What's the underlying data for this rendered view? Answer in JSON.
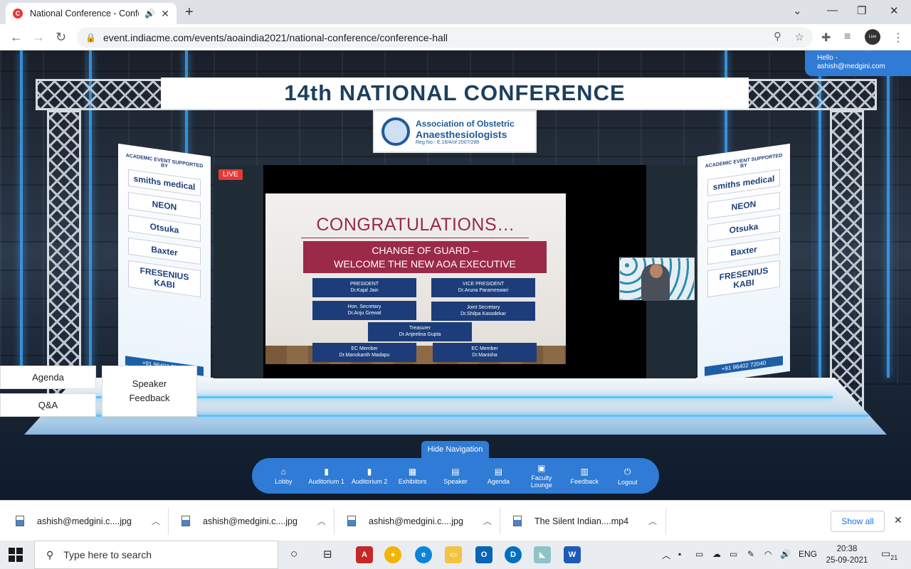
{
  "browser": {
    "tab_title": "National Conference - Confe",
    "url": "event.indiacme.com/events/aoaindia2021/national-conference/conference-hall",
    "profile_label": "Live Truth"
  },
  "page": {
    "hello_line1": "Hello -",
    "hello_line2": "ashish@medgini.com",
    "banner_title": "14th NATIONAL CONFERENCE",
    "logo": {
      "line1": "Association of Obstetric",
      "line2": "Anaesthesiologists",
      "line3": "Reg No:- E.16/4/of 2007/288"
    },
    "live_label": "LIVE",
    "slide": {
      "heading": "CONGRATULATIONS…",
      "banner_line1": "CHANGE OF GUARD –",
      "banner_line2": "WELCOME THE NEW AOA EXECUTIVE",
      "roles": [
        {
          "title": "PRESIDENT",
          "name": "Dr.Kajal Jain"
        },
        {
          "title": "VICE PRESIDENT",
          "name": "Dr.Aruna Parameswari"
        },
        {
          "title": "Hon. Secretary",
          "name": "Dr.Anju Grewal"
        },
        {
          "title": "Joint Secretary",
          "name": "Dr.Shilpa Kasodekar"
        },
        {
          "title": "Treasurer",
          "name": "Dr.Anjeelina Gupta"
        },
        {
          "title": "EC Member",
          "name": "Dr.Manokanth Madapu"
        },
        {
          "title": "EC Member",
          "name": "Dr.Manisha"
        }
      ]
    },
    "side_panel": {
      "heading": "ACADEMIC EVENT SUPPORTED BY",
      "sponsors": [
        "smiths medical",
        "NEON",
        "Otsuka",
        "Baxter",
        "FRESENIUS KABI"
      ],
      "phone": "+91 96402 72040"
    },
    "tiles": {
      "agenda": "Agenda",
      "qa": "Q&A",
      "speaker_feedback_1": "Speaker",
      "speaker_feedback_2": "Feedback"
    },
    "hide_navigation": "Hide Navigation",
    "nav": [
      {
        "label": "Lobby",
        "icon": "home-icon"
      },
      {
        "label": "Auditorium 1",
        "icon": "auditorium-icon"
      },
      {
        "label": "Auditorium 2",
        "icon": "auditorium-icon"
      },
      {
        "label": "Exhibitors",
        "icon": "exhibitors-icon"
      },
      {
        "label": "Speaker",
        "icon": "document-icon"
      },
      {
        "label": "Agenda",
        "icon": "document-icon"
      },
      {
        "label": "Faculty Lounge",
        "icon": "lounge-icon"
      },
      {
        "label": "Feedback",
        "icon": "feedback-icon"
      },
      {
        "label": "Logout",
        "icon": "power-icon"
      }
    ]
  },
  "downloads": {
    "items": [
      "ashish@medgini.c....jpg",
      "ashish@medgini.c....jpg",
      "ashish@medgini.c....jpg",
      "The Silent Indian....mp4"
    ],
    "show_all": "Show all"
  },
  "taskbar": {
    "search_placeholder": "Type here to search",
    "language": "ENG",
    "time": "20:38",
    "date": "25-09-2021",
    "notification_count": "21"
  }
}
